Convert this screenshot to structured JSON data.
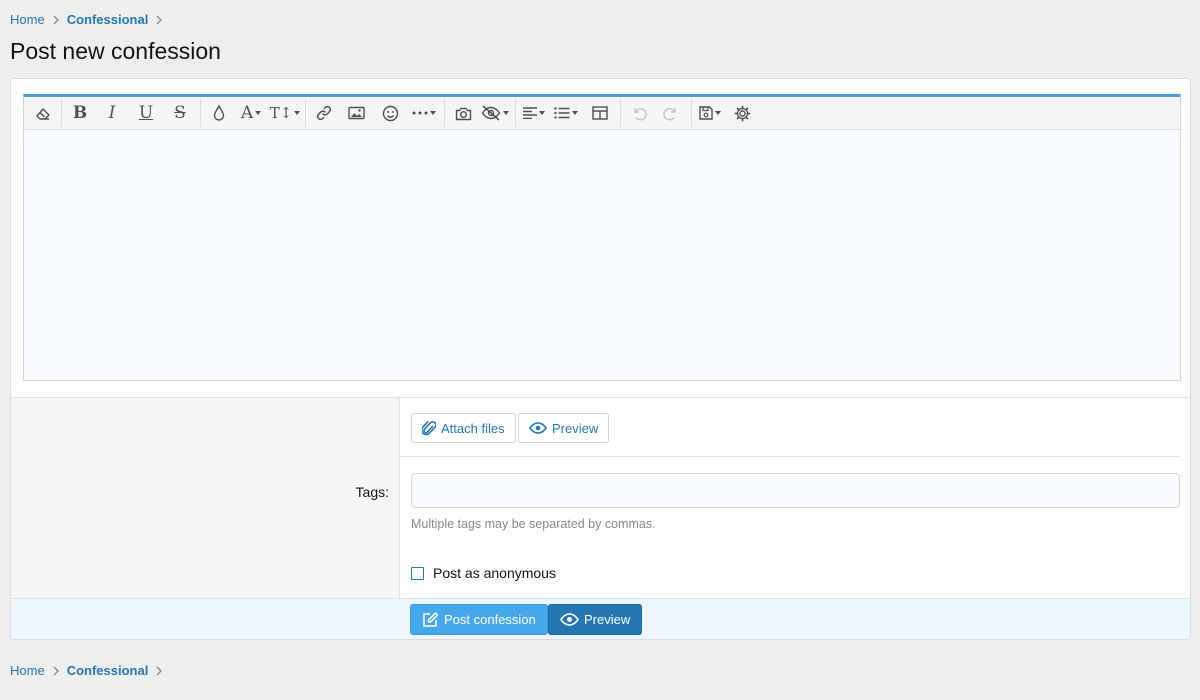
{
  "breadcrumb": {
    "home": "Home",
    "section": "Confessional"
  },
  "page": {
    "title": "Post new confession"
  },
  "toolbar": {
    "buttons": [
      "eraser-icon",
      "bold-icon",
      "italic-icon",
      "underline-icon",
      "strikethrough-icon",
      "text-color-icon",
      "font-family-icon",
      "font-size-icon",
      "link-icon",
      "image-icon",
      "smilie-icon",
      "more-icon",
      "media-icon",
      "spoiler-icon",
      "align-icon",
      "list-icon",
      "table-icon",
      "undo-icon",
      "redo-icon",
      "drafts-icon",
      "settings-icon"
    ],
    "letters": {
      "bold": "B",
      "italic": "I",
      "underline": "U",
      "strike": "S",
      "font": "A",
      "size": "T↕"
    },
    "more": "···"
  },
  "form": {
    "attach_label": "Attach files",
    "preview_label": "Preview",
    "tags_label": "Tags:",
    "tags_value": "",
    "tags_hint": "Multiple tags may be separated by commas.",
    "anonymous_label": "Post as anonymous"
  },
  "actions": {
    "post_label": "Post confession",
    "preview_label": "Preview"
  },
  "colors": {
    "accent": "#2577b1",
    "primary_button": "#47a7eb",
    "editor_border_top": "#4aa3d8"
  }
}
